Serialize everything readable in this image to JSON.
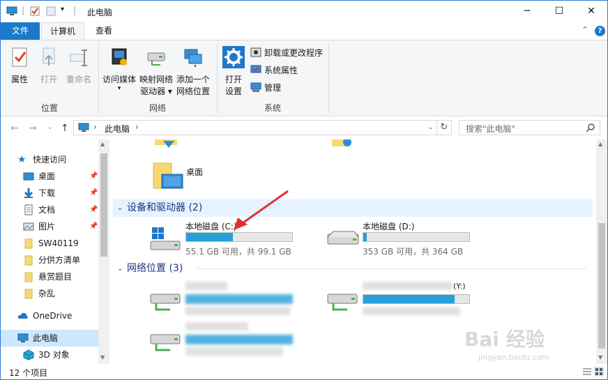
{
  "window": {
    "title": "此电脑",
    "minimize": "─",
    "maximize": "☐",
    "close": "✕"
  },
  "ribbon": {
    "tabs": [
      {
        "label": "文件"
      },
      {
        "label": "计算机"
      },
      {
        "label": "查看"
      }
    ],
    "collapse": "⌃",
    "help": "?",
    "groups": {
      "location": {
        "label": "位置",
        "buttons": [
          {
            "label": "属性"
          },
          {
            "label": "打开"
          },
          {
            "label": "重命名"
          }
        ]
      },
      "network": {
        "label": "网络",
        "buttons": [
          {
            "line1": "访问媒体",
            "line2": "▾"
          },
          {
            "line1": "映射网络",
            "line2": "驱动器 ▾"
          },
          {
            "line1": "添加一个",
            "line2": "网络位置"
          }
        ]
      },
      "system": {
        "label": "系统",
        "open_settings": {
          "line1": "打开",
          "line2": "设置"
        },
        "small": [
          {
            "label": "卸载或更改程序"
          },
          {
            "label": "系统属性"
          },
          {
            "label": "管理"
          }
        ]
      }
    }
  },
  "nav": {
    "back": "←",
    "forward": "→",
    "recent": "⌄",
    "up": "↑",
    "breadcrumb_sep": "›",
    "address": "此电脑",
    "address_dd": "⌄",
    "refresh": "↻",
    "search_placeholder": "搜索\"此电脑\""
  },
  "navpane": {
    "items": [
      {
        "label": "快速访问"
      },
      {
        "label": "桌面"
      },
      {
        "label": "下载"
      },
      {
        "label": "文档"
      },
      {
        "label": "图片"
      },
      {
        "label": "SW40119"
      },
      {
        "label": "分供方清单"
      },
      {
        "label": "悬赏题目"
      },
      {
        "label": "杂乱"
      },
      {
        "label": "OneDrive"
      },
      {
        "label": "此电脑"
      },
      {
        "label": "3D 对象"
      }
    ],
    "pin": "📌"
  },
  "content": {
    "folder_desktop": "桌面",
    "groups": [
      {
        "label": "设备和驱动器 (2)"
      },
      {
        "label": "网络位置 (3)"
      }
    ],
    "drives": [
      {
        "name": "本地磁盘 (C:)",
        "free": "55.1 GB 可用，共 99.1 GB",
        "used_fraction": 0.444
      },
      {
        "name": "本地磁盘 (D:)",
        "free": "353 GB 可用，共 364 GB",
        "used_fraction": 0.03
      }
    ],
    "network_drive_label": "(Y:)"
  },
  "status": {
    "count": "12 个项目"
  },
  "watermark": {
    "brand": "Bai 经验",
    "url": "jingyan.baidu.com"
  },
  "colors": {
    "accent": "#1979ca",
    "drive_bar": "#26a0da",
    "group_header": "#1e3287",
    "selected": "#cce8ff"
  }
}
